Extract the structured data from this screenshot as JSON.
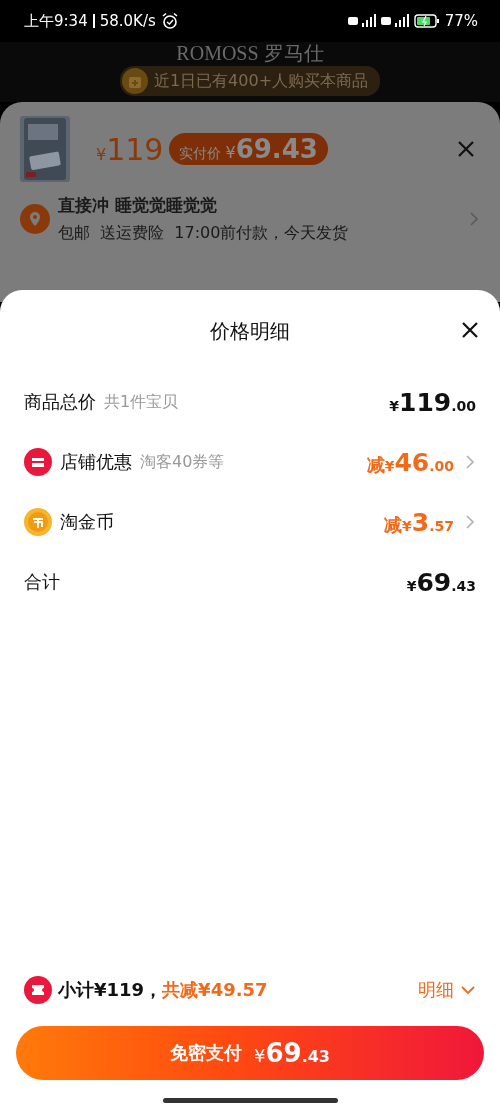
{
  "status_bar": {
    "time": "上午9:34",
    "speed": "58.0K/s",
    "battery": "77%"
  },
  "background_page": {
    "brand": "ROMOSS 罗马仕",
    "badge": "近1日已有400+人购买本商品"
  },
  "product_sheet": {
    "price": "¥119",
    "paid_label": "实付价",
    "paid_price": "¥69.43",
    "address_name": "直接冲 睡觉觉睡觉觉",
    "delivery": "包邮  送运费险  17:00前付款，今天发货"
  },
  "price_detail": {
    "title": "价格明细",
    "rows": [
      {
        "kind": "plain",
        "label": "商品总价",
        "note": "共1件宝贝",
        "amount": "¥119.00",
        "discount": false
      },
      {
        "kind": "shop",
        "label": "店铺优惠",
        "note": "淘客40券等",
        "amount": "减¥46.00",
        "discount": true
      },
      {
        "kind": "coin",
        "label": "淘金币",
        "amount": "减¥3.57",
        "discount": true
      },
      {
        "kind": "plain",
        "label": "合计",
        "amount": "¥69.43",
        "discount": false
      }
    ]
  },
  "summary": {
    "subtotal": "小计¥119，",
    "saving": "共减¥49.57",
    "detail_link": "明细"
  },
  "pay_button": {
    "label": "免密支付",
    "amount": "¥69.43"
  }
}
